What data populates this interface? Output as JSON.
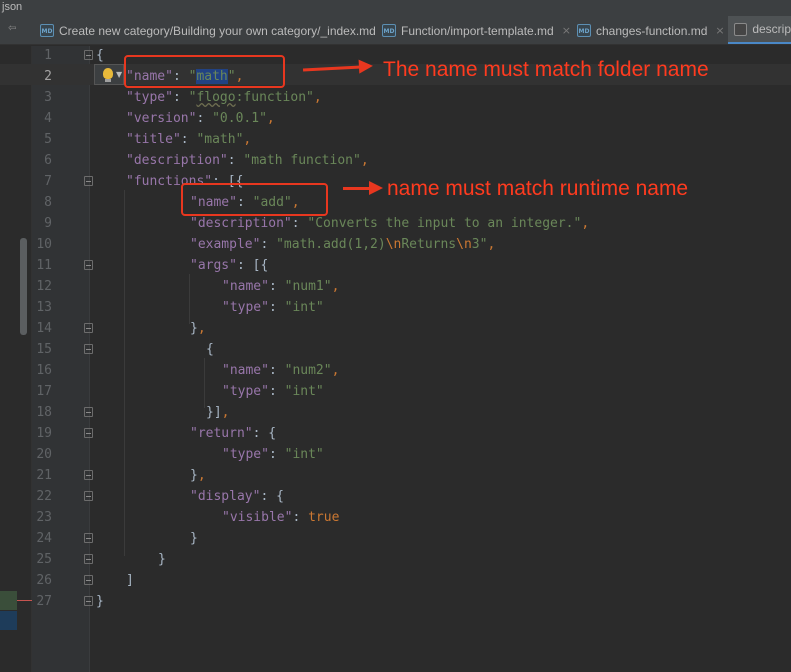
{
  "window": {
    "title": "json"
  },
  "tabs": [
    {
      "label": "Create new category/Building your own category/_index.md",
      "icon": "markdown-file-icon",
      "active": false
    },
    {
      "label": "Function/import-template.md",
      "icon": "markdown-file-icon",
      "active": false
    },
    {
      "label": "changes-function.md",
      "icon": "markdown-file-icon",
      "active": false
    },
    {
      "label": "descrip",
      "icon": "json-file-icon",
      "active": true
    }
  ],
  "tab_close_glyph": "×",
  "icon_text": "MD",
  "editor": {
    "lines": [
      {
        "n": "1",
        "html": "<span class=\"b\">{</span>"
      },
      {
        "n": "2",
        "html": "<span class=\"k\">\"name\"</span><span class=\"b\">: </span><span class=\"s\">\"<span class=\"sel\">math</span>\"</span><span class=\"p\">,</span>"
      },
      {
        "n": "3",
        "html": "<span class=\"k\">\"type\"</span><span class=\"b\">: </span><span class=\"s\">\"<span class=\"wavy\">flogo</span>:function\"</span><span class=\"p\">,</span>"
      },
      {
        "n": "4",
        "html": "<span class=\"k\">\"version\"</span><span class=\"b\">: </span><span class=\"s\">\"0.0.1\"</span><span class=\"p\">,</span>"
      },
      {
        "n": "5",
        "html": "<span class=\"k\">\"title\"</span><span class=\"b\">: </span><span class=\"s\">\"math\"</span><span class=\"p\">,</span>"
      },
      {
        "n": "6",
        "html": "<span class=\"k\">\"description\"</span><span class=\"b\">: </span><span class=\"s\">\"math function\"</span><span class=\"p\">,</span>"
      },
      {
        "n": "7",
        "html": "<span class=\"k\">\"functions\"</span><span class=\"b\">: [{</span>"
      },
      {
        "n": "8",
        "html": "<span class=\"k\">\"name\"</span><span class=\"b\">: </span><span class=\"s\">\"add\"</span><span class=\"p\">,</span>"
      },
      {
        "n": "9",
        "html": "<span class=\"k\">\"description\"</span><span class=\"b\">: </span><span class=\"s\">\"Converts the input to an integer.\"</span><span class=\"p\">,</span>"
      },
      {
        "n": "10",
        "html": "<span class=\"k\">\"example\"</span><span class=\"b\">: </span><span class=\"s\">\"math.add(1,2)<span class=\"esc\">\\n</span>Returns<span class=\"esc\">\\n</span>3\"</span><span class=\"p\">,</span>"
      },
      {
        "n": "11",
        "html": "<span class=\"k\">\"args\"</span><span class=\"b\">: [{</span>"
      },
      {
        "n": "12",
        "html": "<span class=\"k\">\"name\"</span><span class=\"b\">: </span><span class=\"s\">\"num1\"</span><span class=\"p\">,</span>"
      },
      {
        "n": "13",
        "html": "<span class=\"k\">\"type\"</span><span class=\"b\">: </span><span class=\"s\">\"int\"</span>"
      },
      {
        "n": "14",
        "html": "<span class=\"b\">}</span><span class=\"p\">,</span>"
      },
      {
        "n": "15",
        "html": "<span class=\"b\">{</span>"
      },
      {
        "n": "16",
        "html": "<span class=\"k\">\"name\"</span><span class=\"b\">: </span><span class=\"s\">\"num2\"</span><span class=\"p\">,</span>"
      },
      {
        "n": "17",
        "html": "<span class=\"k\">\"type\"</span><span class=\"b\">: </span><span class=\"s\">\"int\"</span>"
      },
      {
        "n": "18",
        "html": "<span class=\"b\">}]</span><span class=\"p\">,</span>"
      },
      {
        "n": "19",
        "html": "<span class=\"k\">\"return\"</span><span class=\"b\">: {</span>"
      },
      {
        "n": "20",
        "html": "<span class=\"k\">\"type\"</span><span class=\"b\">: </span><span class=\"s\">\"int\"</span>"
      },
      {
        "n": "21",
        "html": "<span class=\"b\">}</span><span class=\"p\">,</span>"
      },
      {
        "n": "22",
        "html": "<span class=\"k\">\"display\"</span><span class=\"b\">: {</span>"
      },
      {
        "n": "23",
        "html": "<span class=\"k\">\"visible\"</span><span class=\"b\">: </span><span class=\"kw\">true</span>"
      },
      {
        "n": "24",
        "html": "<span class=\"b\">}</span>"
      },
      {
        "n": "25",
        "html": "<span class=\"b\">}</span>"
      },
      {
        "n": "26",
        "html": "<span class=\"b\">]</span>"
      },
      {
        "n": "27",
        "html": "<span class=\"b\">}</span>"
      }
    ]
  },
  "annotations": {
    "folder_note": "The name must match folder name",
    "runtime_note": "name must match runtime name"
  },
  "colors": {
    "annotation": "#e8371f",
    "json_key": "#9876aa",
    "json_string": "#6a8759",
    "punctuation": "#cc7832",
    "selection": "#214283"
  }
}
